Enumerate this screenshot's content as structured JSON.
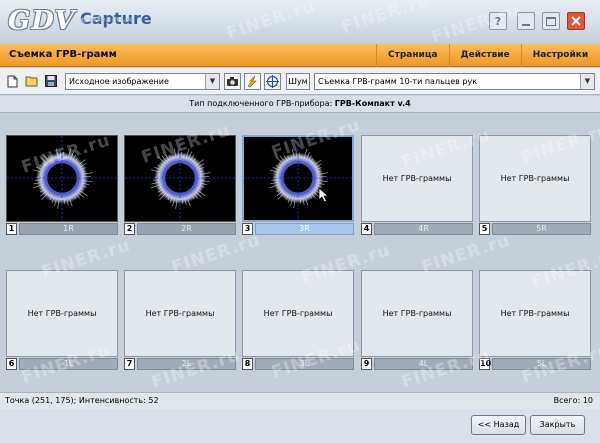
{
  "app": {
    "logo_text": "GDV",
    "logo_sub": "Capture",
    "window_buttons": [
      "help-icon",
      "minimize-icon",
      "maximize-icon",
      "close-icon"
    ],
    "close_color": "#e1543f"
  },
  "menu": {
    "title": "Съемка ГРВ-грамм",
    "items": [
      "Страница",
      "Действие",
      "Настройки"
    ],
    "color": "#f5a93d"
  },
  "toolbar": {
    "image_select_value": "Исходное изображение",
    "noise_label": "Шум",
    "mode_select_value": "Съемка ГРВ-грамм 10-ти пальцев рук"
  },
  "device": {
    "label": "Тип подключенного ГРВ-прибора:",
    "name": "ГРВ-Компакт v.4"
  },
  "tiles": [
    {
      "num": "1",
      "label": "1R",
      "has_image": true
    },
    {
      "num": "2",
      "label": "2R",
      "has_image": true
    },
    {
      "num": "3",
      "label": "3R",
      "has_image": true,
      "selected": true
    },
    {
      "num": "4",
      "label": "4R",
      "has_image": false,
      "empty_text": "Нет ГРВ-граммы"
    },
    {
      "num": "5",
      "label": "5R",
      "has_image": false,
      "empty_text": "Нет ГРВ-граммы"
    },
    {
      "num": "6",
      "label": "1L",
      "has_image": false,
      "empty_text": "Нет ГРВ-граммы"
    },
    {
      "num": "7",
      "label": "2L",
      "has_image": false,
      "empty_text": "Нет ГРВ-граммы"
    },
    {
      "num": "8",
      "label": "3L",
      "has_image": false,
      "empty_text": "Нет ГРВ-граммы"
    },
    {
      "num": "9",
      "label": "4L",
      "has_image": false,
      "empty_text": "Нет ГРВ-граммы"
    },
    {
      "num": "10",
      "label": "5L",
      "has_image": false,
      "empty_text": "Нет ГРВ-граммы"
    }
  ],
  "watermark": "FINER.ru",
  "status": {
    "point": "Точка (251, 175); Интенсивность: 52",
    "total": "Всего: 10"
  },
  "footer": {
    "back_label": "<< Назад",
    "close_label": "Закрыть"
  }
}
